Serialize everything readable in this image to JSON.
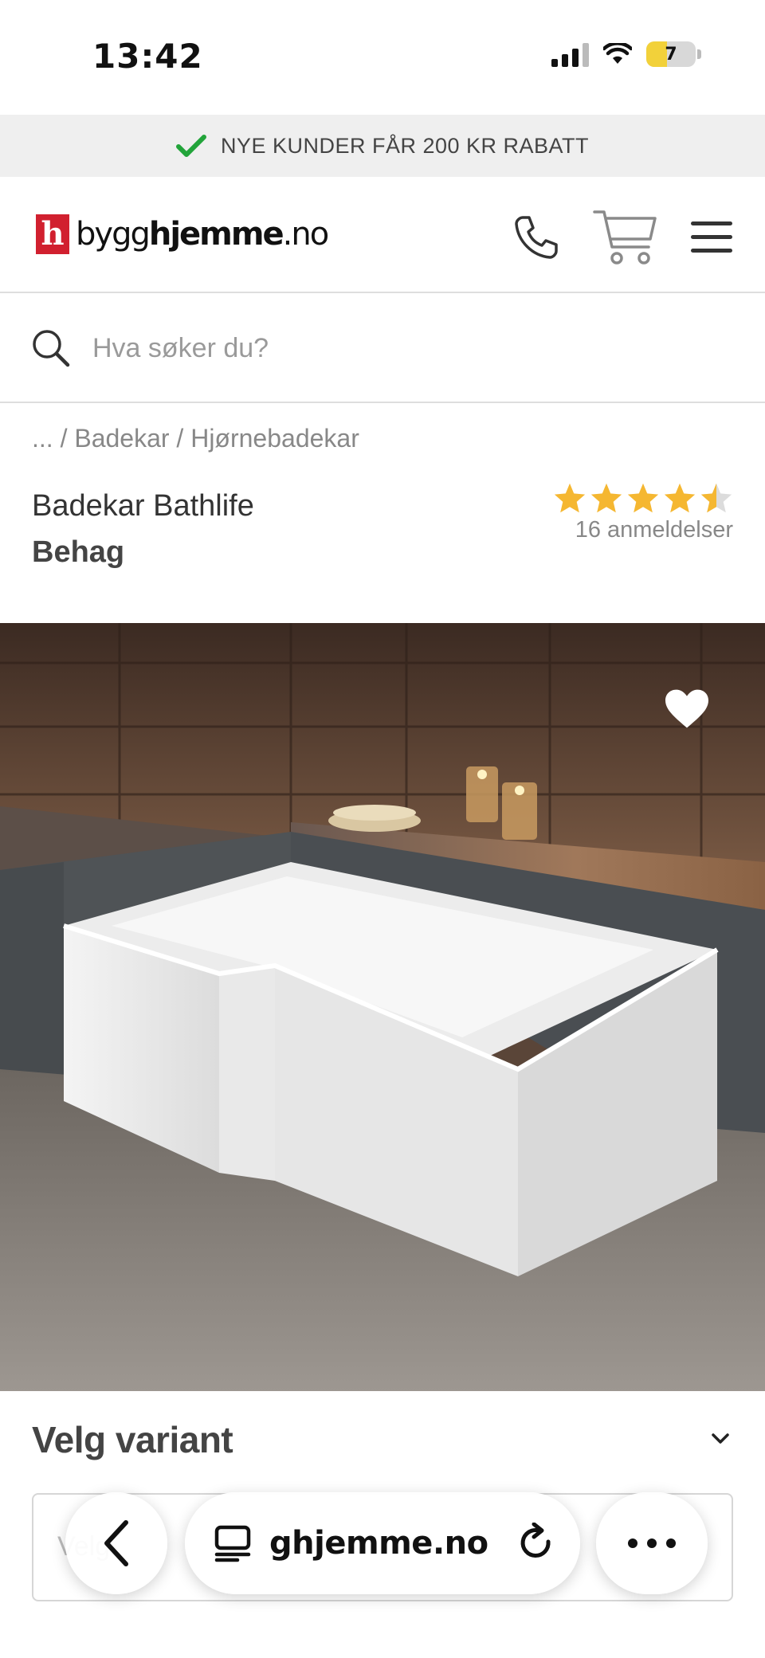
{
  "status_bar": {
    "time": "13:42",
    "battery": "7"
  },
  "promo": {
    "text": "NYE KUNDER FÅR 200 KR RABATT",
    "icon": "check-icon",
    "icon_color": "#22a43a"
  },
  "header": {
    "logo_mark": "h",
    "logo_prefix": "bygg",
    "logo_bold": "hjemme",
    "logo_suffix": ".no",
    "brand_color": "#d1202f",
    "icons": [
      "phone-icon",
      "cart-icon",
      "menu-icon"
    ]
  },
  "search": {
    "placeholder": "Hva søker du?"
  },
  "breadcrumb": {
    "text": "... / Badekar / Hjørnebadekar"
  },
  "product": {
    "name": "Badekar Bathlife",
    "brand": "Behag",
    "rating": 4.5,
    "rating_max": 5,
    "reviews": "16 anmeldelser",
    "star_color": "#f5b731"
  },
  "variant": {
    "heading": "Velg variant",
    "placeholder": "Velg"
  },
  "safari": {
    "url": "bygghjemme.no",
    "url_visible": "ghjemme.no"
  }
}
